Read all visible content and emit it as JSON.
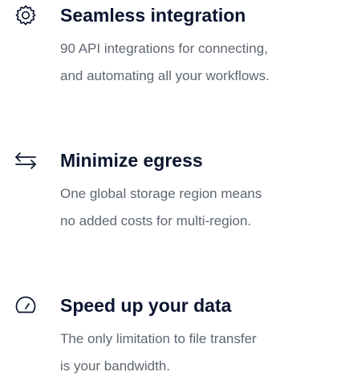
{
  "features": [
    {
      "icon": "gear-icon",
      "title": "Seamless integration",
      "description_lines": [
        "90 API integrations for connecting,",
        "and automating all your workflows."
      ]
    },
    {
      "icon": "arrows-exchange-icon",
      "title": "Minimize egress",
      "description_lines": [
        "One global storage region means",
        "no added costs for multi-region."
      ]
    },
    {
      "icon": "speedometer-icon",
      "title": "Speed up your data",
      "description_lines": [
        "The only limitation to file transfer",
        "is your bandwidth."
      ]
    }
  ],
  "colors": {
    "title": "#0b1530",
    "description": "#5f6772",
    "icon": "#0b1530"
  }
}
